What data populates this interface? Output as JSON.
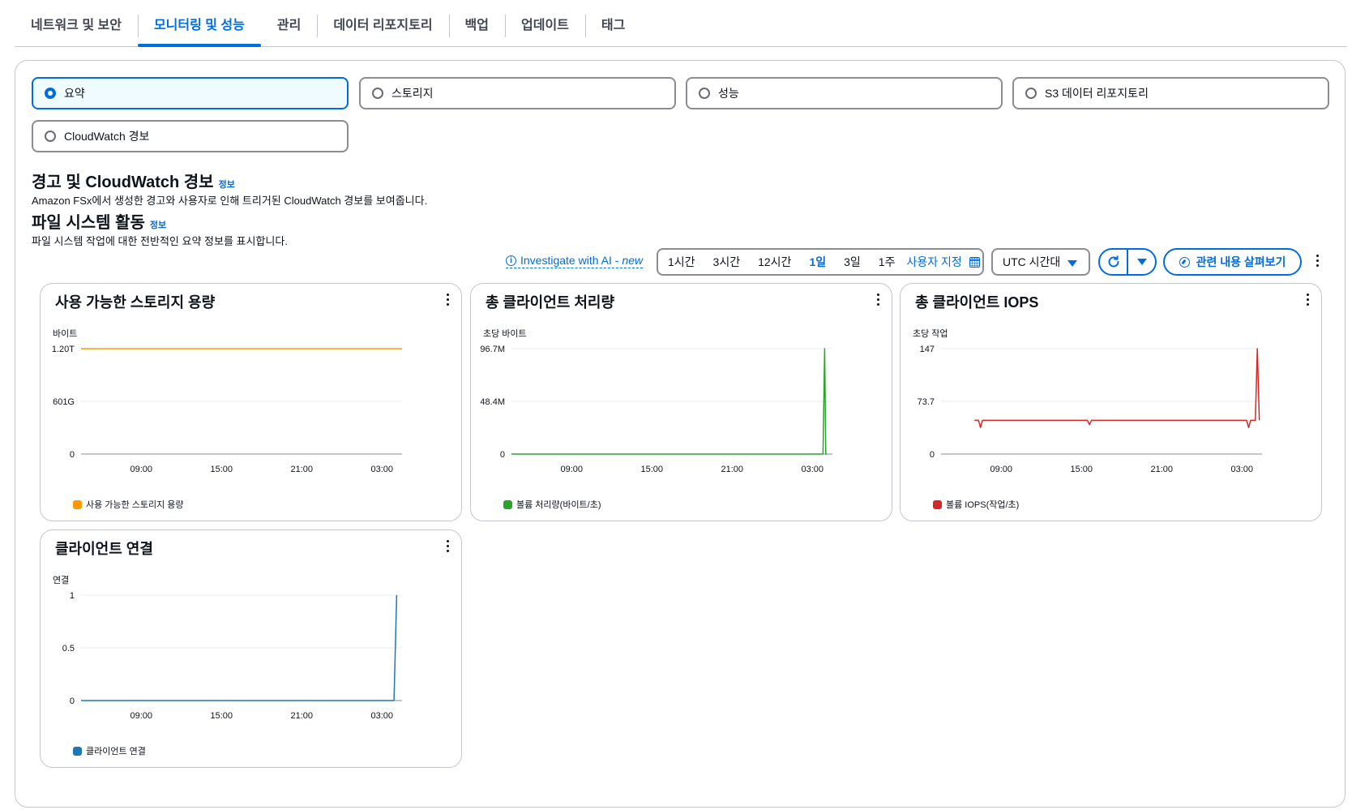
{
  "tabs": [
    {
      "label": "네트워크 및 보안",
      "active": false
    },
    {
      "label": "모니터링 및 성능",
      "active": true
    },
    {
      "label": "관리",
      "active": false
    },
    {
      "label": "데이터 리포지토리",
      "active": false
    },
    {
      "label": "백업",
      "active": false
    },
    {
      "label": "업데이트",
      "active": false
    },
    {
      "label": "태그",
      "active": false
    }
  ],
  "view_options": {
    "summary": "요약",
    "storage": "스토리지",
    "performance": "성능",
    "s3_repo": "S3 데이터 리포지토리",
    "cloudwatch": "CloudWatch 경보",
    "selected": "summary"
  },
  "alerts_section": {
    "title": "경고 및 CloudWatch 경보",
    "info": "정보",
    "description": "Amazon FSx에서 생성한 경고와 사용자로 인해 트리거된 CloudWatch 경보를 보여줍니다."
  },
  "activity_section": {
    "title": "파일 시스템 활동",
    "info": "정보",
    "description": "파일 시스템 작업에 대한 전반적인 요약 정보를 표시합니다."
  },
  "toolbar": {
    "investigate_label": "Investigate with AI - ",
    "investigate_new": "new",
    "ranges": [
      "1시간",
      "3시간",
      "12시간",
      "1일",
      "3일",
      "1주"
    ],
    "active_range": "1일",
    "custom_range": "사용자 지정",
    "timezone": "UTC 시간대",
    "explore_label": "관련 내용 살펴보기"
  },
  "colors": {
    "accent": "#006ce0",
    "storage_series": "#ff9900",
    "throughput_series": "#29a329",
    "iops_series": "#d62728",
    "connections_series": "#1f77b4"
  },
  "chart_data": [
    {
      "type": "line",
      "title": "사용 가능한 스토리지 용량",
      "ylabel": "바이트",
      "yticks": [
        "1.20T",
        "601G",
        "0"
      ],
      "xticks": [
        "09:00",
        "15:00",
        "21:00",
        "03:00"
      ],
      "xrange_hours": [
        4.5,
        28.5
      ],
      "ylim": [
        0,
        1.2
      ],
      "series": [
        {
          "name": "사용 가능한 스토리지 용량",
          "color": "#ff9900",
          "x": [
            4.5,
            28.5
          ],
          "y": [
            1.2,
            1.2
          ]
        }
      ]
    },
    {
      "type": "line",
      "title": "총 클라이언트 처리량",
      "ylabel": "초당 바이트",
      "yticks": [
        "96.7M",
        "48.4M",
        "0"
      ],
      "xticks": [
        "09:00",
        "15:00",
        "21:00",
        "03:00"
      ],
      "xrange_hours": [
        4.5,
        28.5
      ],
      "ylim": [
        0,
        96.7
      ],
      "series": [
        {
          "name": "볼륨 처리량(바이트/초)",
          "color": "#29a329",
          "x": [
            4.5,
            27.8,
            27.92,
            28.0,
            28.08
          ],
          "y": [
            0,
            0,
            96.7,
            0,
            0
          ]
        }
      ]
    },
    {
      "type": "line",
      "title": "총 클라이언트 IOPS",
      "ylabel": "초당 작업",
      "yticks": [
        "147",
        "73.7",
        "0"
      ],
      "xticks": [
        "09:00",
        "15:00",
        "21:00",
        "03:00"
      ],
      "xrange_hours": [
        4.5,
        28.5
      ],
      "ylim": [
        0,
        147
      ],
      "series": [
        {
          "name": "볼륨 IOPS(작업/초)",
          "color": "#d62728",
          "x": [
            7.0,
            7.3,
            7.45,
            7.6,
            9.0,
            15.0,
            15.45,
            15.6,
            15.75,
            21.0,
            27.0,
            27.35,
            27.5,
            27.65,
            28.0,
            28.15,
            28.3
          ],
          "y": [
            47,
            47,
            37,
            47,
            47,
            47,
            47,
            41,
            47,
            47,
            47,
            47,
            37,
            47,
            47,
            147,
            47
          ]
        }
      ]
    },
    {
      "type": "line",
      "title": "클라이언트 연결",
      "ylabel": "연결",
      "yticks": [
        "1",
        "0.5",
        "0"
      ],
      "xticks": [
        "09:00",
        "15:00",
        "21:00",
        "03:00"
      ],
      "xrange_hours": [
        4.5,
        28.5
      ],
      "ylim": [
        0,
        1
      ],
      "series": [
        {
          "name": "클라이언트 연결",
          "color": "#1f77b4",
          "x": [
            4.5,
            27.9,
            28.1
          ],
          "y": [
            0,
            0,
            1
          ]
        }
      ]
    }
  ]
}
